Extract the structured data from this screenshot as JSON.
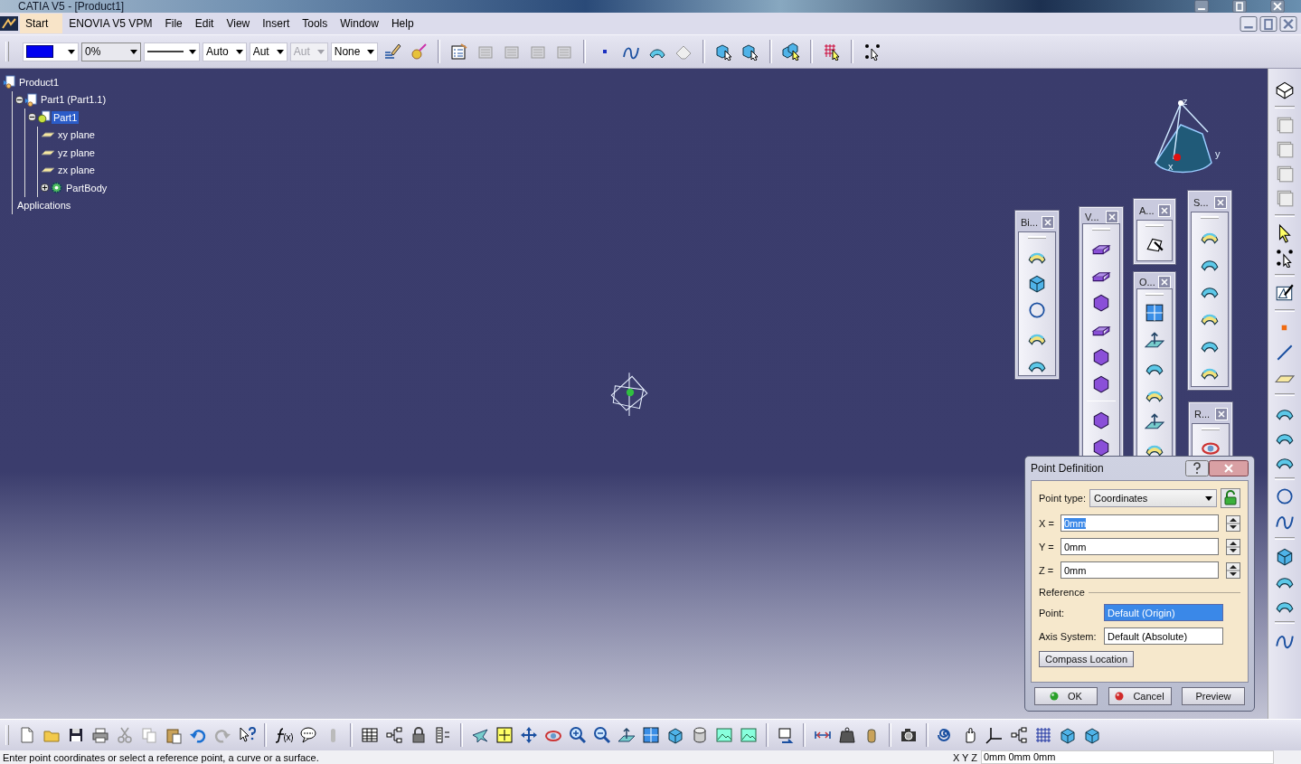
{
  "window": {
    "title": "CATIA V5 - [Product1]"
  },
  "menu": [
    {
      "label": "Start",
      "selected": true
    },
    {
      "label": "ENOVIA V5 VPM",
      "selected": false
    },
    {
      "label": "File",
      "selected": false
    },
    {
      "label": "Edit",
      "selected": false
    },
    {
      "label": "View",
      "selected": false
    },
    {
      "label": "Insert",
      "selected": false
    },
    {
      "label": "Tools",
      "selected": false
    },
    {
      "label": "Window",
      "selected": false
    },
    {
      "label": "Help",
      "selected": false
    }
  ],
  "dropdowns": [
    {
      "kind": "swatch",
      "disabled": false
    },
    {
      "kind": "text",
      "value": "0%",
      "disabled": false
    },
    {
      "kind": "line",
      "disabled": false
    },
    {
      "kind": "text",
      "value": "Auto",
      "disabled": false
    },
    {
      "kind": "text",
      "value": "Aut",
      "disabled": false
    },
    {
      "kind": "text",
      "value": "Aut",
      "disabled": true
    },
    {
      "kind": "text",
      "value": "None",
      "disabled": false
    }
  ],
  "tree": [
    {
      "label": "Product1",
      "kind": "product",
      "selected": false,
      "children": [
        {
          "label": "Part1 (Part1.1)",
          "kind": "product",
          "selected": false,
          "expanded": true,
          "children": [
            {
              "label": "Part1",
              "kind": "part",
              "selected": true,
              "expanded": true,
              "children": [
                {
                  "label": "xy plane",
                  "kind": "plane",
                  "selected": false
                },
                {
                  "label": "yz plane",
                  "kind": "plane",
                  "selected": false
                },
                {
                  "label": "zx plane",
                  "kind": "plane",
                  "selected": false
                },
                {
                  "label": "PartBody",
                  "kind": "body",
                  "selected": false,
                  "expanded": false
                }
              ]
            }
          ]
        },
        {
          "label": "Applications",
          "kind": "none",
          "selected": false
        }
      ]
    }
  ],
  "floating_toolbars": [
    {
      "title": "Bi..."
    },
    {
      "title": "V..."
    },
    {
      "title": "A..."
    },
    {
      "title": "O..."
    },
    {
      "title": "S..."
    },
    {
      "title": "R..."
    }
  ],
  "compass": {
    "axes": [
      "z",
      "y",
      "x"
    ]
  },
  "dialog": {
    "title": "Point Definition",
    "point_type": {
      "label": "Point type:",
      "value": "Coordinates"
    },
    "coordinates": [
      {
        "label": "X =",
        "value": "0mm",
        "selected": true
      },
      {
        "label": "Y =",
        "value": "0mm",
        "selected": false
      },
      {
        "label": "Z =",
        "value": "0mm",
        "selected": false
      }
    ],
    "reference": {
      "heading": "Reference",
      "fields": [
        {
          "label": "Point:",
          "value": "Default (Origin)",
          "selected": true
        },
        {
          "label": "Axis System:",
          "value": "Default (Absolute)",
          "selected": false
        }
      ]
    },
    "compass_button": "Compass Location",
    "buttons": [
      {
        "label": "OK",
        "kind": "ok"
      },
      {
        "label": "Cancel",
        "kind": "cancel"
      },
      {
        "label": "Preview",
        "kind": "plain"
      }
    ]
  },
  "status_bar": {
    "message": "Enter point coordinates or select a reference point, a curve or a surface.",
    "coordinates_label": "X Y Z",
    "coordinates_value": "0mm 0mm 0mm"
  }
}
